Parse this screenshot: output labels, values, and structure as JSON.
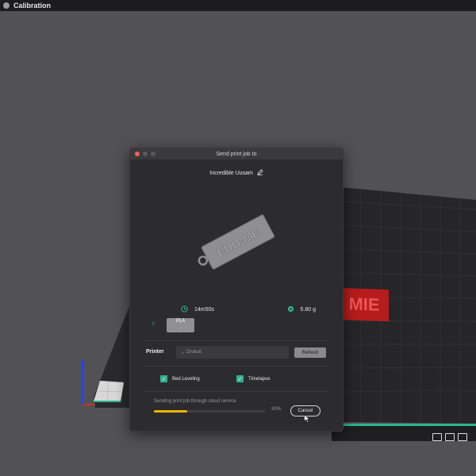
{
  "window": {
    "title": "Calibration"
  },
  "scene": {
    "model_text": "MIE",
    "colors": {
      "bed_accent": "#2fb38f",
      "model_red": "#b71c1c",
      "background": "#525254"
    },
    "toolbar_icons": [
      "cube-icon",
      "screen-icon",
      "trash-icon"
    ]
  },
  "dialog": {
    "title": "Send print job to",
    "job_name": "Incredible Uusam",
    "edit_icon": "pencil-icon",
    "preview_text": "EDU-ME",
    "print_time": "14m50s",
    "weight": "5.80 g",
    "filament": {
      "material": "PLA",
      "slot": "-"
    },
    "help_label": "?",
    "printer_label": "Printer",
    "printer_value": "Drukuš",
    "refresh_label": "Refresh",
    "options": [
      {
        "label": "Bed Leveling",
        "checked": true
      },
      {
        "label": "Timelapse",
        "checked": true
      }
    ],
    "status_text": "Sending print job through cloud service",
    "progress": {
      "percent_label": "30%",
      "value": 0.3
    },
    "cancel_label": "Cancel",
    "accent_color": "#2fb38f",
    "progress_color": "#f0b400"
  }
}
